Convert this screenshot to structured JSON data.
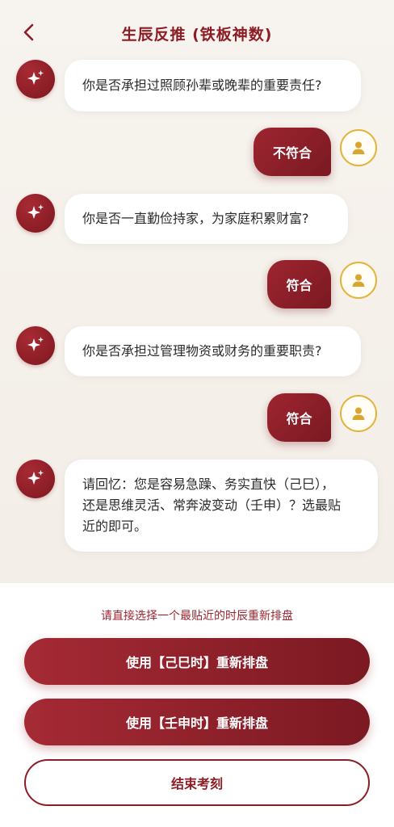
{
  "header": {
    "title": "生辰反推 (铁板神数)",
    "back_icon": "chevron-left-icon"
  },
  "colors": {
    "accent": "#8c1d25",
    "user_avatar_ring": "#e2b43c"
  },
  "messages": [
    {
      "role": "bot",
      "text": "你是否承担过照顾孙辈或晚辈的重要责任?"
    },
    {
      "role": "user",
      "text": "不符合"
    },
    {
      "role": "bot",
      "text": "你是否一直勤俭持家，为家庭积累财富?"
    },
    {
      "role": "user",
      "text": "符合"
    },
    {
      "role": "bot",
      "text": "你是否承担过管理物资或财务的重要职责?"
    },
    {
      "role": "user",
      "text": "符合"
    },
    {
      "role": "bot",
      "lines": [
        "请回忆：您是容易急躁、务实直快（己巳），",
        "还是思维灵活、常奔波变动（壬申）？选最贴",
        "近的即可。"
      ]
    }
  ],
  "bottom": {
    "hint": "请直接选择一个最贴近的时辰重新排盘",
    "option1_label": "使用【己巳时】重新排盘",
    "option2_label": "使用【壬申时】重新排盘",
    "end_label": "结束考刻"
  }
}
